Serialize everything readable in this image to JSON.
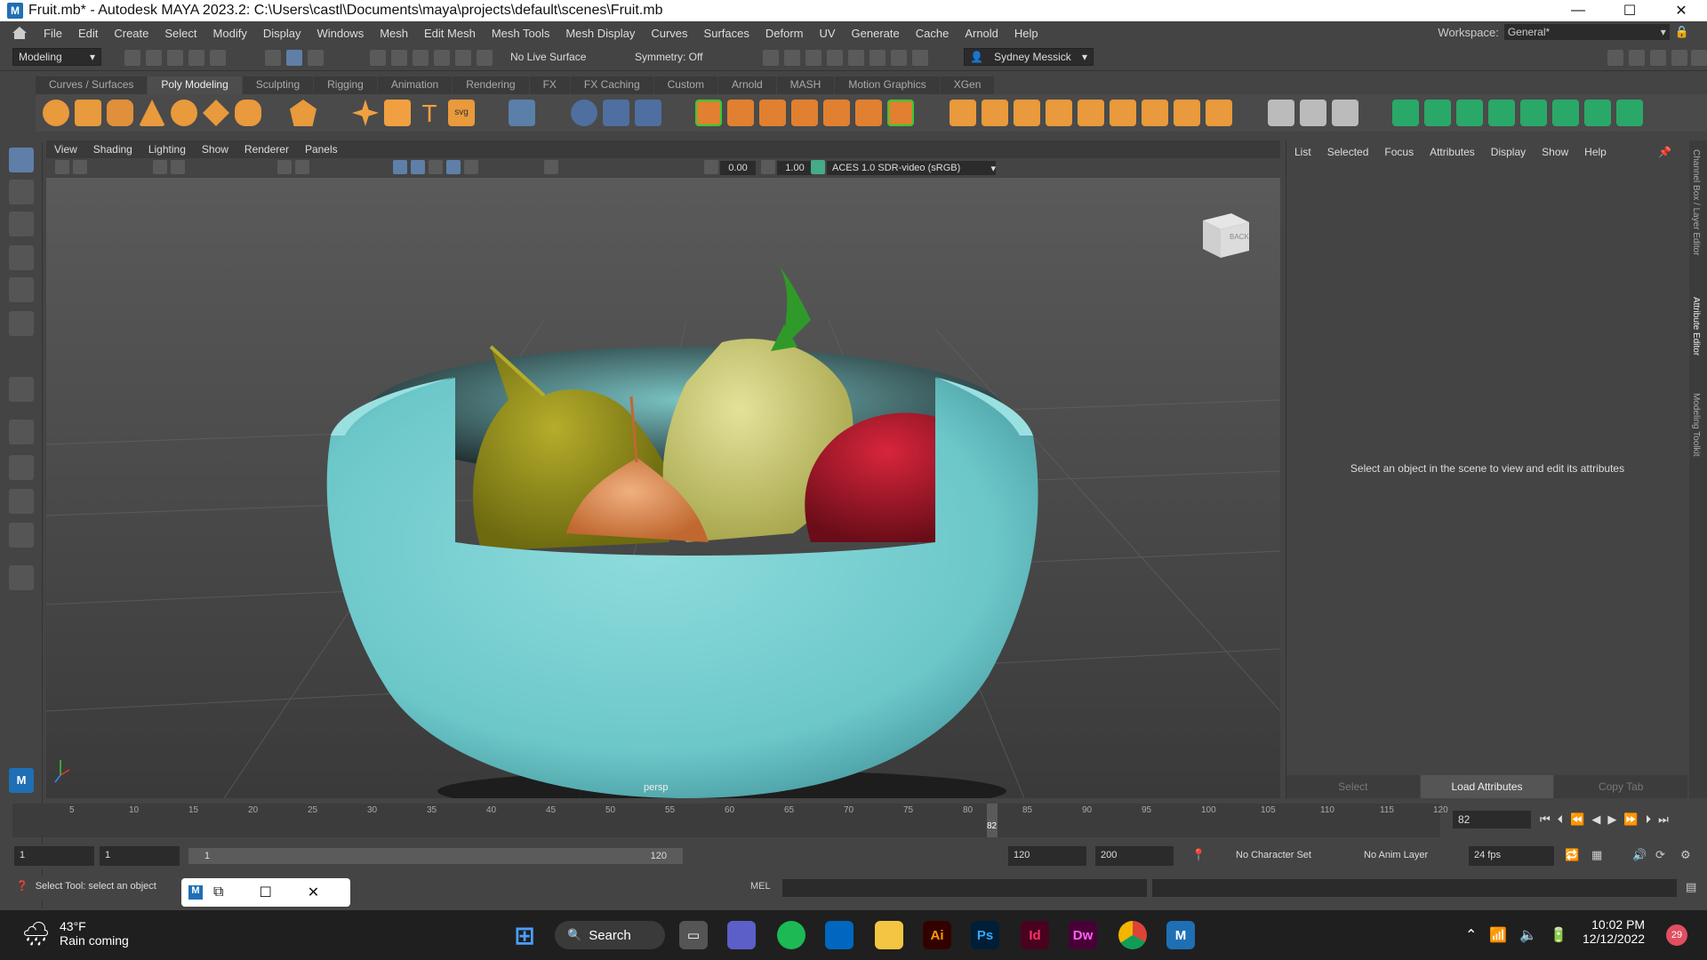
{
  "window": {
    "title": "Fruit.mb* - Autodesk MAYA 2023.2: C:\\Users\\castl\\Documents\\maya\\projects\\default\\scenes\\Fruit.mb",
    "app_icon": "M",
    "controls": [
      "—",
      "☐",
      "✕"
    ]
  },
  "menubar": {
    "items": [
      "File",
      "Edit",
      "Create",
      "Select",
      "Modify",
      "Display",
      "Windows",
      "Mesh",
      "Edit Mesh",
      "Mesh Tools",
      "Mesh Display",
      "Curves",
      "Surfaces",
      "Deform",
      "UV",
      "Generate",
      "Cache",
      "Arnold",
      "Help"
    ],
    "workspace_label": "Workspace:",
    "workspace_value": "General*"
  },
  "statusline": {
    "mode": "Modeling",
    "live_surface": "No Live Surface",
    "symmetry": "Symmetry: Off",
    "user": "Sydney Messick"
  },
  "shelf": {
    "tabs": [
      "Curves / Surfaces",
      "Poly Modeling",
      "Sculpting",
      "Rigging",
      "Animation",
      "Rendering",
      "FX",
      "FX Caching",
      "Custom",
      "Arnold",
      "MASH",
      "Motion Graphics",
      "XGen"
    ],
    "active_tab": "Poly Modeling"
  },
  "viewport": {
    "menu": [
      "View",
      "Shading",
      "Lighting",
      "Show",
      "Renderer",
      "Panels"
    ],
    "exposure": "0.00",
    "gamma": "1.00",
    "color_space": "ACES 1.0 SDR-video (sRGB)",
    "camera_label": "persp",
    "viewcube_face": "BACK"
  },
  "attribute_editor": {
    "menu": [
      "List",
      "Selected",
      "Focus",
      "Attributes",
      "Display",
      "Show",
      "Help"
    ],
    "message": "Select an object in the scene to view and edit its attributes",
    "buttons": [
      "Select",
      "Load Attributes",
      "Copy Tab"
    ],
    "side_tabs": [
      "Channel Box / Layer Editor",
      "Attribute Editor",
      "Modeling Toolkit"
    ]
  },
  "timeline": {
    "ticks": [
      "5",
      "10",
      "15",
      "20",
      "25",
      "30",
      "35",
      "40",
      "45",
      "50",
      "55",
      "60",
      "65",
      "70",
      "75",
      "80",
      "85",
      "90",
      "95",
      "100",
      "105",
      "110",
      "115",
      "120"
    ],
    "current_frame": "82",
    "frame_field": "82"
  },
  "range": {
    "start": "1",
    "anim_start": "1",
    "slider_start": "1",
    "slider_end": "120",
    "end": "120",
    "anim_end": "200",
    "character_set": "No Character Set",
    "anim_layer": "No Anim Layer",
    "fps": "24 fps"
  },
  "cmdline": {
    "help": "Select Tool: select an object",
    "lang": "MEL"
  },
  "taskbar": {
    "weather_temp": "43°F",
    "weather_text": "Rain coming",
    "search": "Search",
    "time": "10:02 PM",
    "date": "12/12/2022",
    "notifications": "29",
    "app_labels": [
      "Ai",
      "Ps",
      "Id",
      "Dw",
      "M"
    ]
  }
}
